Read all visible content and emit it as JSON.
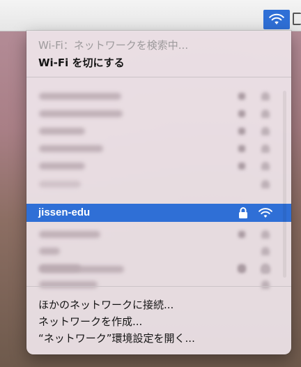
{
  "wifi_menu": {
    "status_text": "Wi-Fi：ネットワークを検索中...",
    "toggle_label": "Wi-Fi を切にする",
    "selected_network": "jissen-edu",
    "blurred_networks": [
      {
        "lock": true
      },
      {
        "lock": true
      },
      {
        "lock": true
      },
      {
        "lock": true
      },
      {
        "lock": true
      },
      {
        "lock": true
      },
      {
        "lock": true
      },
      {
        "lock": false
      },
      {
        "lock": true
      },
      {
        "lock": false
      },
      {
        "lock": true
      }
    ],
    "actions": [
      "ほかのネットワークに接続...",
      "ネットワークを作成...",
      "“ネットワーク”環境設定を開く..."
    ]
  },
  "colors": {
    "accent": "#2f6fd6",
    "menu_bg": "#eee4e9",
    "disabled_text": "#9d9a9c"
  },
  "icons": [
    "wifi-icon",
    "lock-icon",
    "battery-icon"
  ]
}
